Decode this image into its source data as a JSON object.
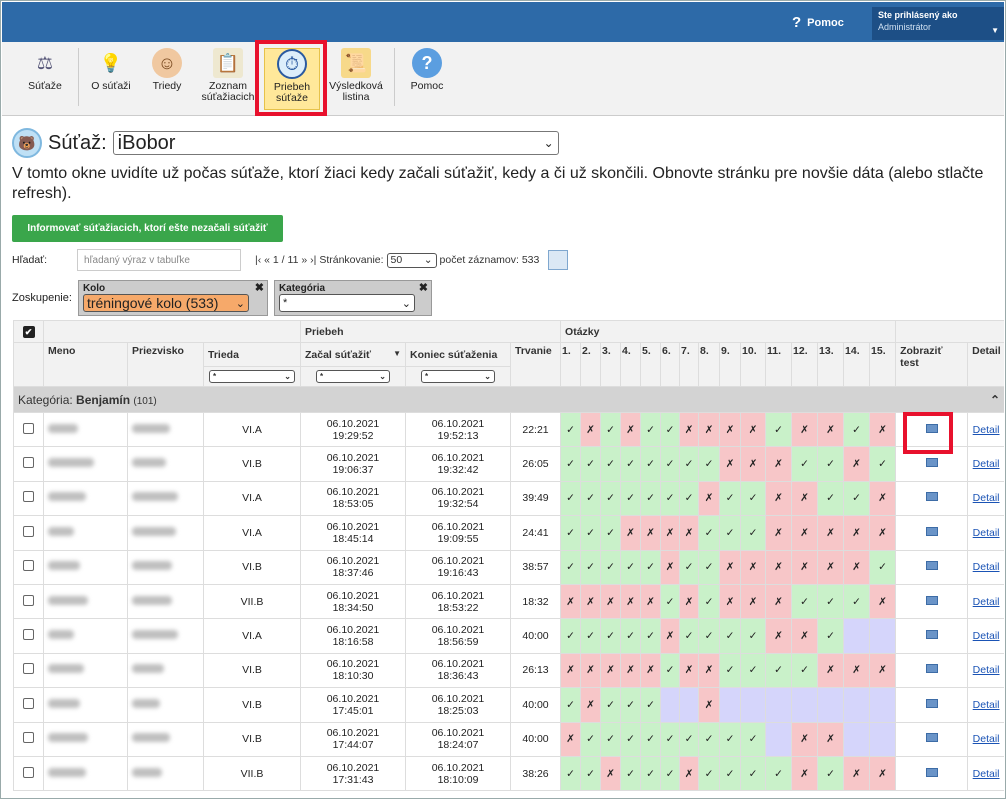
{
  "header": {
    "help_label": "Pomoc",
    "user_label": "Ste prihlásený ako",
    "user_name": "Administrátor"
  },
  "toolbar": [
    {
      "label": "Súťaže",
      "icon": "scales-icon"
    },
    {
      "label": "O súťaži",
      "icon": "lightbulb-icon"
    },
    {
      "label": "Triedy",
      "icon": "person-icon"
    },
    {
      "label": "Zoznam súťažiacich",
      "icon": "clipboard-icon"
    },
    {
      "label": "Priebeh súťaže",
      "icon": "stopwatch-icon",
      "selected": true
    },
    {
      "label": "Výsledková listina",
      "icon": "certificate-icon"
    },
    {
      "label": "Pomoc",
      "icon": "help-icon"
    }
  ],
  "contest": {
    "label": "Súťaž:",
    "value": "iBobor"
  },
  "description": "V tomto okne uvidíte už počas súťaže, ktorí žiaci kedy začali súťažiť, kedy a či už skončili. Obnovte stránku pre novšie dáta (alebo stlačte refresh).",
  "inform_button": "Informovať súťažiacich, ktorí ešte nezačali súťažiť",
  "search": {
    "label": "Hľadať:",
    "placeholder": "hľadaný výraz v tabuľke"
  },
  "pager": {
    "nav": "|‹ « 1 / 11 » ›|",
    "page_size_label": "Stránkovanie:",
    "page_size": "50",
    "count_label": "počet záznamov: 533"
  },
  "grouping": {
    "label": "Zoskupenie:",
    "kolo_title": "Kolo",
    "kolo_value": "tréningové kolo (533)",
    "kategoria_title": "Kategória",
    "kategoria_value": "*"
  },
  "table": {
    "priebeh": "Priebeh",
    "otazky": "Otázky",
    "cols": {
      "meno": "Meno",
      "priezvisko": "Priezvisko",
      "trieda": "Trieda",
      "zacal": "Začal súťažiť",
      "koniec": "Koniec súťaženia",
      "trvanie": "Trvanie",
      "zobrazit": "Zobraziť test",
      "detail": "Detail"
    },
    "filter": "*",
    "questions": [
      "1.",
      "2.",
      "3.",
      "4.",
      "5.",
      "6.",
      "7.",
      "8.",
      "9.",
      "10.",
      "11.",
      "12.",
      "13.",
      "14.",
      "15."
    ],
    "category_prefix": "Kategória:",
    "category_name": "Benjamín",
    "category_count": "(101)",
    "detail_link": "Detail",
    "rows": [
      {
        "trieda": "VI.A",
        "start_date": "06.10.2021",
        "start_time": "19:29:52",
        "end_date": "06.10.2021",
        "end_time": "19:52:13",
        "trvanie": "22:21",
        "answers": "ynynyynnnnynnyn"
      },
      {
        "trieda": "VI.B",
        "start_date": "06.10.2021",
        "start_time": "19:06:37",
        "end_date": "06.10.2021",
        "end_time": "19:32:42",
        "trvanie": "26:05",
        "answers": "yyyyyyyynnnyyny"
      },
      {
        "trieda": "VI.A",
        "start_date": "06.10.2021",
        "start_time": "18:53:05",
        "end_date": "06.10.2021",
        "end_time": "19:32:54",
        "trvanie": "39:49",
        "answers": "yyyyyyynyynnyyn"
      },
      {
        "trieda": "VI.A",
        "start_date": "06.10.2021",
        "start_time": "18:45:14",
        "end_date": "06.10.2021",
        "end_time": "19:09:55",
        "trvanie": "24:41",
        "answers": "yyynnnnyyynnnnn"
      },
      {
        "trieda": "VI.B",
        "start_date": "06.10.2021",
        "start_time": "18:37:46",
        "end_date": "06.10.2021",
        "end_time": "19:16:43",
        "trvanie": "38:57",
        "answers": "yyyyynyynnnnnny"
      },
      {
        "trieda": "VII.B",
        "start_date": "06.10.2021",
        "start_time": "18:34:50",
        "end_date": "06.10.2021",
        "end_time": "18:53:22",
        "trvanie": "18:32",
        "answers": "nnnnnynynnnyyyn"
      },
      {
        "trieda": "VI.A",
        "start_date": "06.10.2021",
        "start_time": "18:16:58",
        "end_date": "06.10.2021",
        "end_time": "18:56:59",
        "trvanie": "40:00",
        "answers": "yyyyynyyyynnyuu"
      },
      {
        "trieda": "VI.B",
        "start_date": "06.10.2021",
        "start_time": "18:10:30",
        "end_date": "06.10.2021",
        "end_time": "18:36:43",
        "trvanie": "26:13",
        "answers": "nnnnnynnyyyynnn"
      },
      {
        "trieda": "VI.B",
        "start_date": "06.10.2021",
        "start_time": "17:45:01",
        "end_date": "06.10.2021",
        "end_time": "18:25:03",
        "trvanie": "40:00",
        "answers": "ynyyyuunuuuuuuu"
      },
      {
        "trieda": "VI.B",
        "start_date": "06.10.2021",
        "start_time": "17:44:07",
        "end_date": "06.10.2021",
        "end_time": "18:24:07",
        "trvanie": "40:00",
        "answers": "nyyyyyyyyyunnuu"
      },
      {
        "trieda": "VII.B",
        "start_date": "06.10.2021",
        "start_time": "17:31:43",
        "end_date": "06.10.2021",
        "end_time": "18:10:09",
        "trvanie": "38:26",
        "answers": "yynyyynyyyynynn"
      }
    ]
  },
  "colors": {
    "header_blue": "#2d6aa8",
    "correct": "#c9f1c9",
    "wrong": "#f7c6c8",
    "unanswered": "#d5d5fb",
    "button_green": "#3aa64b"
  }
}
